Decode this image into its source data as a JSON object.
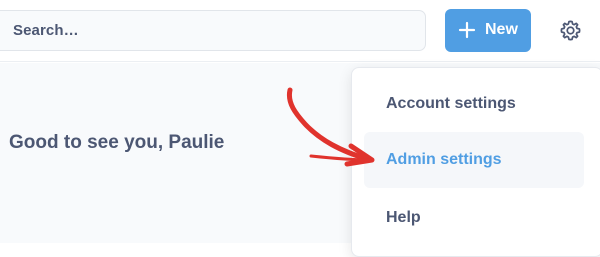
{
  "header": {
    "search": {
      "placeholder": "Search…"
    },
    "new_button": {
      "label": "New",
      "icon": "plus-icon"
    },
    "settings_icon": "gear-icon"
  },
  "main": {
    "greeting": "Good to see you, Paulie"
  },
  "settings_menu": {
    "items": [
      {
        "label": "Account settings",
        "active": false
      },
      {
        "label": "Admin settings",
        "active": true
      },
      {
        "label": "Help",
        "active": false
      }
    ]
  },
  "annotation": {
    "type": "red-arrow",
    "target": "Admin settings",
    "color": "#e0332d"
  },
  "colors": {
    "accent": "#509ee3",
    "text": "#4c5773",
    "background": "#f8fafc"
  }
}
